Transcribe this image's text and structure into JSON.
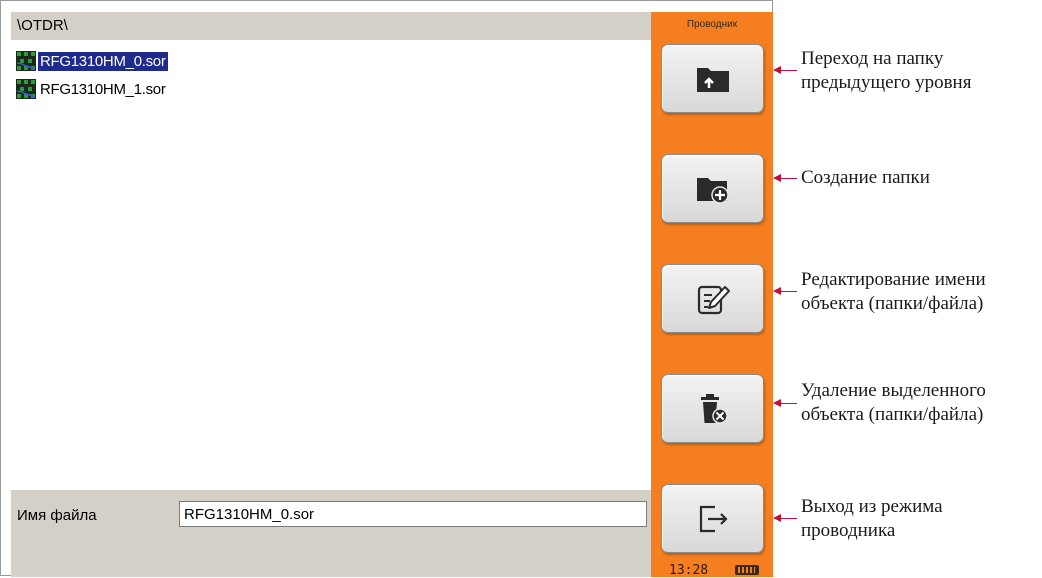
{
  "path": "\\OTDR\\",
  "files": [
    {
      "name": "RFG1310HM_0.sor",
      "selected": true
    },
    {
      "name": "RFG1310HM_1.sor",
      "selected": false
    }
  ],
  "filename_field": {
    "label": "Имя файла",
    "value": "RFG1310HM_0.sor"
  },
  "side_panel": {
    "title": "Проводник",
    "buttons": [
      {
        "icon": "folder-up-icon"
      },
      {
        "icon": "folder-add-icon"
      },
      {
        "icon": "edit-icon"
      },
      {
        "icon": "trash-delete-icon"
      },
      {
        "icon": "exit-icon"
      }
    ]
  },
  "status": {
    "time": "13:28",
    "battery_icon": "battery-icon"
  },
  "callouts": [
    {
      "line1": "Переход на папку",
      "line2": "предыдущего уровня"
    },
    {
      "line1": "Создание папки"
    },
    {
      "line1": "Редактирование имени",
      "line2": "объекта (папки/файла)"
    },
    {
      "line1": "Удаление выделенного",
      "line2": "объекта (папки/файла)"
    },
    {
      "line1": "Выход из режима",
      "line2": "проводника"
    }
  ],
  "colors": {
    "panel_orange": "#f57f20",
    "selection": "#1e2a8c",
    "pointer": "#c0113a",
    "gray": "#d4d0c8"
  }
}
